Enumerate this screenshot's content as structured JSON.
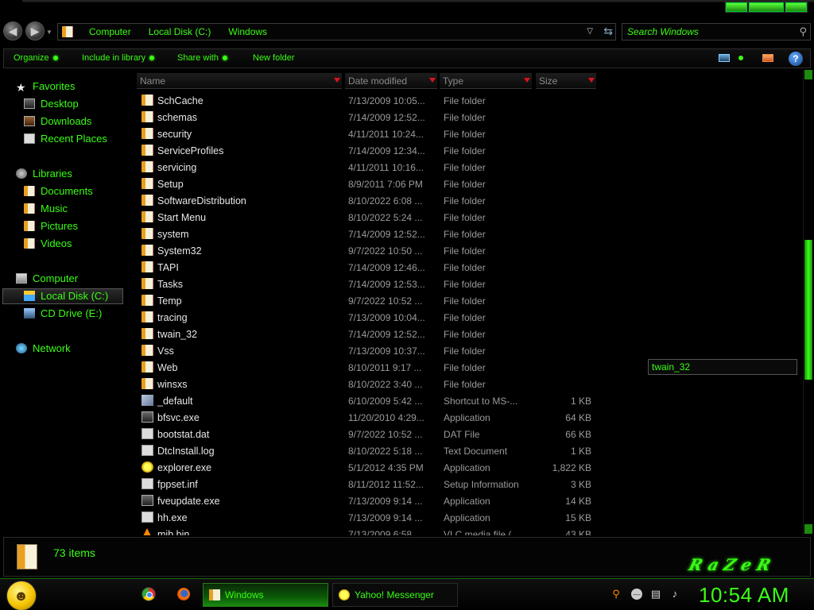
{
  "navigation": {
    "breadcrumbs": [
      "Computer",
      "Local Disk (C:)",
      "Windows"
    ],
    "search_placeholder": "Search Windows"
  },
  "toolbar": {
    "organize": "Organize",
    "include_in_library": "Include in library",
    "share_with": "Share with",
    "new_folder": "New folder"
  },
  "sidebar": {
    "favorites": {
      "label": "Favorites",
      "items": [
        "Desktop",
        "Downloads",
        "Recent Places"
      ]
    },
    "libraries": {
      "label": "Libraries",
      "items": [
        "Documents",
        "Music",
        "Pictures",
        "Videos"
      ]
    },
    "computer": {
      "label": "Computer",
      "items": [
        "Local Disk (C:)",
        "CD Drive (E:)"
      ]
    },
    "network": {
      "label": "Network"
    },
    "selected": "Local Disk (C:)"
  },
  "columns": [
    "Name",
    "Date modified",
    "Type",
    "Size"
  ],
  "files": [
    {
      "name": "SchCache",
      "date": "7/13/2009 10:05...",
      "type": "File folder",
      "size": "",
      "icon": "folder"
    },
    {
      "name": "schemas",
      "date": "7/14/2009 12:52...",
      "type": "File folder",
      "size": "",
      "icon": "folder"
    },
    {
      "name": "security",
      "date": "4/11/2011 10:24...",
      "type": "File folder",
      "size": "",
      "icon": "folder"
    },
    {
      "name": "ServiceProfiles",
      "date": "7/14/2009 12:34...",
      "type": "File folder",
      "size": "",
      "icon": "folder"
    },
    {
      "name": "servicing",
      "date": "4/11/2011 10:16...",
      "type": "File folder",
      "size": "",
      "icon": "folder"
    },
    {
      "name": "Setup",
      "date": "8/9/2011 7:06 PM",
      "type": "File folder",
      "size": "",
      "icon": "folder"
    },
    {
      "name": "SoftwareDistribution",
      "date": "8/10/2022 6:08 ...",
      "type": "File folder",
      "size": "",
      "icon": "folder"
    },
    {
      "name": "Start Menu",
      "date": "8/10/2022 5:24 ...",
      "type": "File folder",
      "size": "",
      "icon": "folder"
    },
    {
      "name": "system",
      "date": "7/14/2009 12:52...",
      "type": "File folder",
      "size": "",
      "icon": "folder"
    },
    {
      "name": "System32",
      "date": "9/7/2022 10:50 ...",
      "type": "File folder",
      "size": "",
      "icon": "folder"
    },
    {
      "name": "TAPI",
      "date": "7/14/2009 12:46...",
      "type": "File folder",
      "size": "",
      "icon": "folder"
    },
    {
      "name": "Tasks",
      "date": "7/14/2009 12:53...",
      "type": "File folder",
      "size": "",
      "icon": "folder"
    },
    {
      "name": "Temp",
      "date": "9/7/2022 10:52 ...",
      "type": "File folder",
      "size": "",
      "icon": "folder"
    },
    {
      "name": "tracing",
      "date": "7/13/2009 10:04...",
      "type": "File folder",
      "size": "",
      "icon": "folder"
    },
    {
      "name": "twain_32",
      "date": "7/14/2009 12:52...",
      "type": "File folder",
      "size": "",
      "icon": "folder"
    },
    {
      "name": "Vss",
      "date": "7/13/2009 10:37...",
      "type": "File folder",
      "size": "",
      "icon": "folder"
    },
    {
      "name": "Web",
      "date": "8/10/2011 9:17 ...",
      "type": "File folder",
      "size": "",
      "icon": "folder"
    },
    {
      "name": "winsxs",
      "date": "8/10/2022 3:40 ...",
      "type": "File folder",
      "size": "",
      "icon": "folder"
    },
    {
      "name": "_default",
      "date": "6/10/2009 5:42 ...",
      "type": "Shortcut to MS-...",
      "size": "1 KB",
      "icon": "shortcut"
    },
    {
      "name": "bfsvc.exe",
      "date": "11/20/2010 4:29...",
      "type": "Application",
      "size": "64 KB",
      "icon": "exe"
    },
    {
      "name": "bootstat.dat",
      "date": "9/7/2022 10:52 ...",
      "type": "DAT File",
      "size": "66 KB",
      "icon": "file"
    },
    {
      "name": "DtcInstall.log",
      "date": "8/10/2022 5:18 ...",
      "type": "Text Document",
      "size": "1 KB",
      "icon": "file"
    },
    {
      "name": "explorer.exe",
      "date": "5/1/2012 4:35 PM",
      "type": "Application",
      "size": "1,822 KB",
      "icon": "yellow"
    },
    {
      "name": "fppset.inf",
      "date": "8/11/2012 11:52...",
      "type": "Setup Information",
      "size": "3 KB",
      "icon": "file"
    },
    {
      "name": "fveupdate.exe",
      "date": "7/13/2009 9:14 ...",
      "type": "Application",
      "size": "14 KB",
      "icon": "exe"
    },
    {
      "name": "hh.exe",
      "date": "7/13/2009 9:14 ...",
      "type": "Application",
      "size": "15 KB",
      "icon": "file"
    },
    {
      "name": "mib.bin",
      "date": "7/13/2009 6:58 ...",
      "type": "VLC media file (...",
      "size": "43 KB",
      "icon": "vlc"
    }
  ],
  "tooltip": "twain_32",
  "details": {
    "item_count": "73 items"
  },
  "logo_text": "RaZeR",
  "taskbar": {
    "tasks": [
      "Windows",
      "Yahoo! Messenger"
    ],
    "clock": "10:54 AM"
  },
  "colors": {
    "accent": "#39ff14",
    "background": "#000000",
    "header_arrow": "#dd1122"
  }
}
